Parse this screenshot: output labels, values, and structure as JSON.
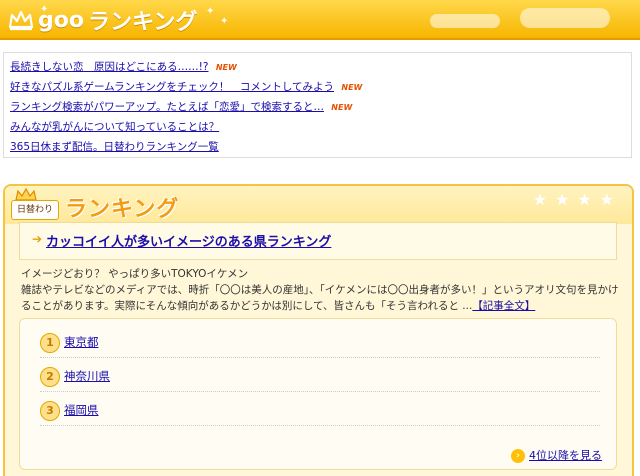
{
  "header": {
    "logo": "goo",
    "title": "ランキング"
  },
  "news": {
    "items": [
      {
        "text": "長続きしない恋　原因はどこにある……!?",
        "new": true
      },
      {
        "text": "好きなパズル系ゲームランキングをチェック！　コメントしてみよう",
        "new": true
      },
      {
        "text": "ランキング検索がパワーアップ。たとえば「恋愛」で検索すると…",
        "new": true
      },
      {
        "text": "みんなが乳がんについて知っていることは？",
        "new": false
      },
      {
        "text": "365日休まず配信。日替わりランキング一覧",
        "new": false
      }
    ],
    "new_label": "NEW"
  },
  "ranking": {
    "badge": "日替わり",
    "title": "ランキング",
    "article_title": "カッコイイ人が多いイメージのある県ランキング",
    "lead": "イメージどおり？ やっぱり多いTOKYOイケメン",
    "body": "雑誌やテレビなどのメディアでは、時折「〇〇は美人の産地」、「イケメンには〇〇出身者が多い！」というアオリ文句を見かけることがあります。実際にそんな傾向があるかどうかは別にして、皆さんも「そう言われると ...",
    "full_text_link": "【記事全文】",
    "list": [
      {
        "rank": "1",
        "name": "東京都"
      },
      {
        "rank": "2",
        "name": "神奈川県"
      },
      {
        "rank": "3",
        "name": "福岡県"
      }
    ],
    "more": "4位以降を見る"
  }
}
